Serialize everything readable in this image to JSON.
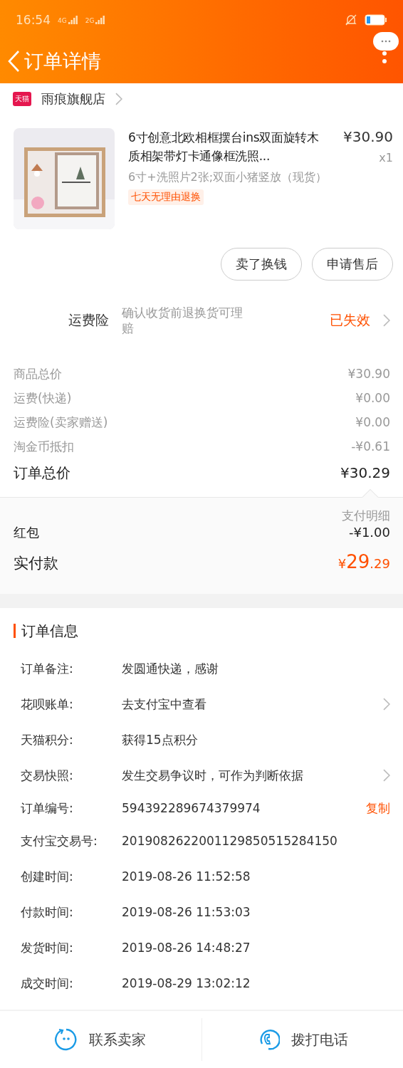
{
  "status_bar": {
    "time": "16:54",
    "network_1": "4G",
    "network_2": "2G"
  },
  "header": {
    "title": "订单详情"
  },
  "shop": {
    "badge": "天猫",
    "name": "雨痕旗舰店"
  },
  "product": {
    "title": "6寸创意北欧相框摆台ins双面旋转木质相架带灯卡通像框洗照...",
    "price": "¥30.90",
    "quantity": "x1",
    "spec": "6寸+洗照片2张;双面小猪竖放（现货）",
    "tag": "七天无理由退换"
  },
  "actions": [
    "卖了换钱",
    "申请售后"
  ],
  "insurance": {
    "label": "运费险",
    "description": "确认收货前退换货可理赔",
    "status": "已失效"
  },
  "costs": [
    {
      "label": "商品总价",
      "value": "¥30.90"
    },
    {
      "label": "运费(快递)",
      "value": "¥0.00"
    },
    {
      "label": "运费险(卖家赠送)",
      "value": "¥0.00"
    },
    {
      "label": "淘金币抵扣",
      "value": "-¥0.61"
    }
  ],
  "order_total": {
    "label": "订单总价",
    "value": "¥30.29"
  },
  "payment": {
    "link": "支付明细",
    "red_packet_label": "红包",
    "red_packet_value": "-¥1.00",
    "paid_label": "实付款",
    "paid_currency": "¥",
    "paid_integer": "29",
    "paid_decimal": ".29"
  },
  "order_info": {
    "title": "订单信息",
    "rows": [
      {
        "label": "订单备注:",
        "value": "发圆通快递，感谢",
        "kind": "plain"
      },
      {
        "label": "花呗账单:",
        "value": "去支付宝中查看",
        "kind": "link"
      },
      {
        "label": "天猫积分:",
        "value": "获得15点积分",
        "kind": "plain"
      },
      {
        "label": "交易快照:",
        "value": "发生交易争议时，可作为判断依据",
        "kind": "link"
      },
      {
        "label": "订单编号:",
        "value": "594392289674379974",
        "kind": "copy",
        "action": "复制"
      },
      {
        "label": "支付宝交易号:",
        "value": "2019082622001129850515284150",
        "kind": "plain"
      },
      {
        "label": "创建时间:",
        "value": "2019-08-26 11:52:58",
        "kind": "plain"
      },
      {
        "label": "付款时间:",
        "value": "2019-08-26 11:53:03",
        "kind": "plain"
      },
      {
        "label": "发货时间:",
        "value": "2019-08-26 14:48:27",
        "kind": "plain"
      },
      {
        "label": "成交时间:",
        "value": "2019-08-29 13:02:12",
        "kind": "plain"
      }
    ]
  },
  "bottom_bar": [
    {
      "label": "联系卖家",
      "kind": "chat"
    },
    {
      "label": "拨打电话",
      "kind": "phone"
    }
  ]
}
